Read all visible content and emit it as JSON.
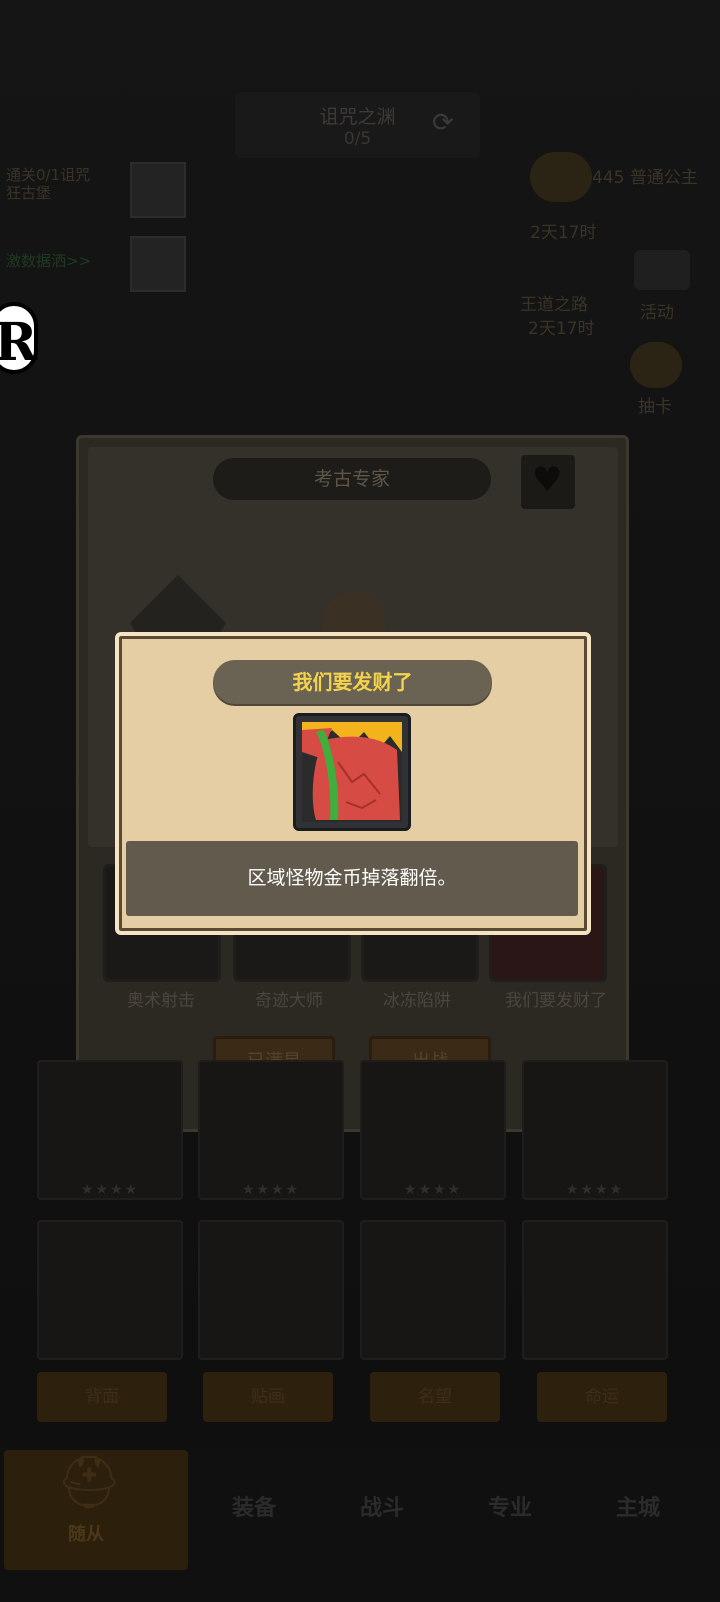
{
  "hud": {
    "quest_title": "诅咒之渊",
    "quest_progress": "0/5",
    "left_quests": [
      "通关0/1诅咒",
      "狂古堡",
      "激数据洒>>"
    ],
    "right_menu": [
      {
        "label": "445 普通公主",
        "sub": "2天17时"
      },
      {
        "label": "活动"
      },
      {
        "label": "王道之路",
        "sub": "2天17时"
      },
      {
        "label": "抽卡"
      }
    ]
  },
  "hero_panel": {
    "name": "考古专家",
    "skills": [
      "奥术射击",
      "奇迹大师",
      "冰冻陷阱",
      "我们要发财了"
    ],
    "buttons": {
      "max_star": "已满星",
      "deploy": "出战"
    }
  },
  "grid": {
    "stars": "★★★★",
    "tabs": [
      "背面",
      "贴画",
      "名望",
      "命运"
    ]
  },
  "bottom_nav": {
    "team": "随从",
    "equipment": "装备",
    "battle": "战斗",
    "profession": "专业",
    "city": "主城"
  },
  "popup": {
    "title": "我们要发财了",
    "item_icon": "money-bag-icon",
    "description": "区域怪物金币掉落翻倍。",
    "colors": {
      "title_text": "#f2d34b",
      "panel": "#e6cea4",
      "band": "#625a4c",
      "bag": "#d64b44",
      "ribbon": "#3fae3c"
    }
  }
}
